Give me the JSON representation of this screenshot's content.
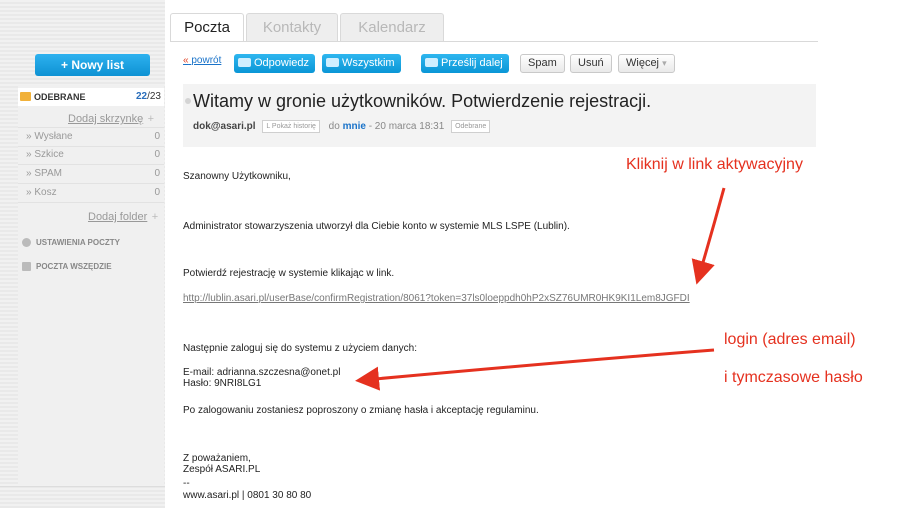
{
  "tabs": [
    {
      "label": "Poczta"
    },
    {
      "label": "Kontakty"
    },
    {
      "label": "Kalendarz"
    }
  ],
  "sidebar": {
    "new_button": "+ Nowy list",
    "inbox": {
      "label": "ODEBRANE",
      "unread": "22",
      "total": "/23"
    },
    "add_mailbox": "Dodaj skrzynkę",
    "folders": [
      {
        "label": "Wysłane",
        "count": "0"
      },
      {
        "label": "Szkice",
        "count": "0"
      },
      {
        "label": "SPAM",
        "count": "0"
      },
      {
        "label": "Kosz",
        "count": "0"
      }
    ],
    "add_folder": "Dodaj folder",
    "settings": "USTAWIENIA POCZTY",
    "everywhere": "POCZTA WSZĘDZIE"
  },
  "toolbar": {
    "back": "powrót",
    "reply": "Odpowiedz",
    "reply_all": "Wszystkim",
    "forward": "Prześlij dalej",
    "spam": "Spam",
    "delete": "Usuń",
    "more": "Więcej"
  },
  "message": {
    "subject": "Witamy w gronie użytkowników. Potwierdzenie rejestracji.",
    "from": "dok@asari.pl",
    "show_history": "Pokaż historię",
    "to_prefix": "do",
    "to": "mnie",
    "date": "- 20 marca 18:31",
    "folder_badge": "Odebrane",
    "greeting": "Szanowny Użytkowniku,",
    "line1": "Administrator stowarzyszenia utworzył dla Ciebie konto w systemie MLS LSPE (Lublin).",
    "line2": "Potwierdź rejestrację w systemie klikając w link.",
    "link": "http://lublin.asari.pl/userBase/confirmRegistration/8061?token=37ls0loeppdh0hP2xSZ76UMR0HK9KI1Lem8JGFDI",
    "line3": "Następnie zaloguj się do systemu z użyciem danych:",
    "email_line": "E-mail: adrianna.szczesna@onet.pl",
    "password_line": "Hasło: 9NRI8LG1",
    "line4": "Po zalogowaniu zostaniesz poproszony o zmianę hasła i akceptację regulaminu.",
    "closing": "Z poważaniem,",
    "team": "Zespół ASARI.PL",
    "sig_sep": "--",
    "sig": "www.asari.pl | 0801 30 80 80"
  },
  "annotations": {
    "a1": "Kliknij w link aktywacyjny",
    "a2": "login (adres email)",
    "a3": "i tymczasowe hasło",
    "color": "#e5311f"
  },
  "colors": {
    "accent_blue": "#0e92d3",
    "link_blue": "#1a73c9"
  }
}
